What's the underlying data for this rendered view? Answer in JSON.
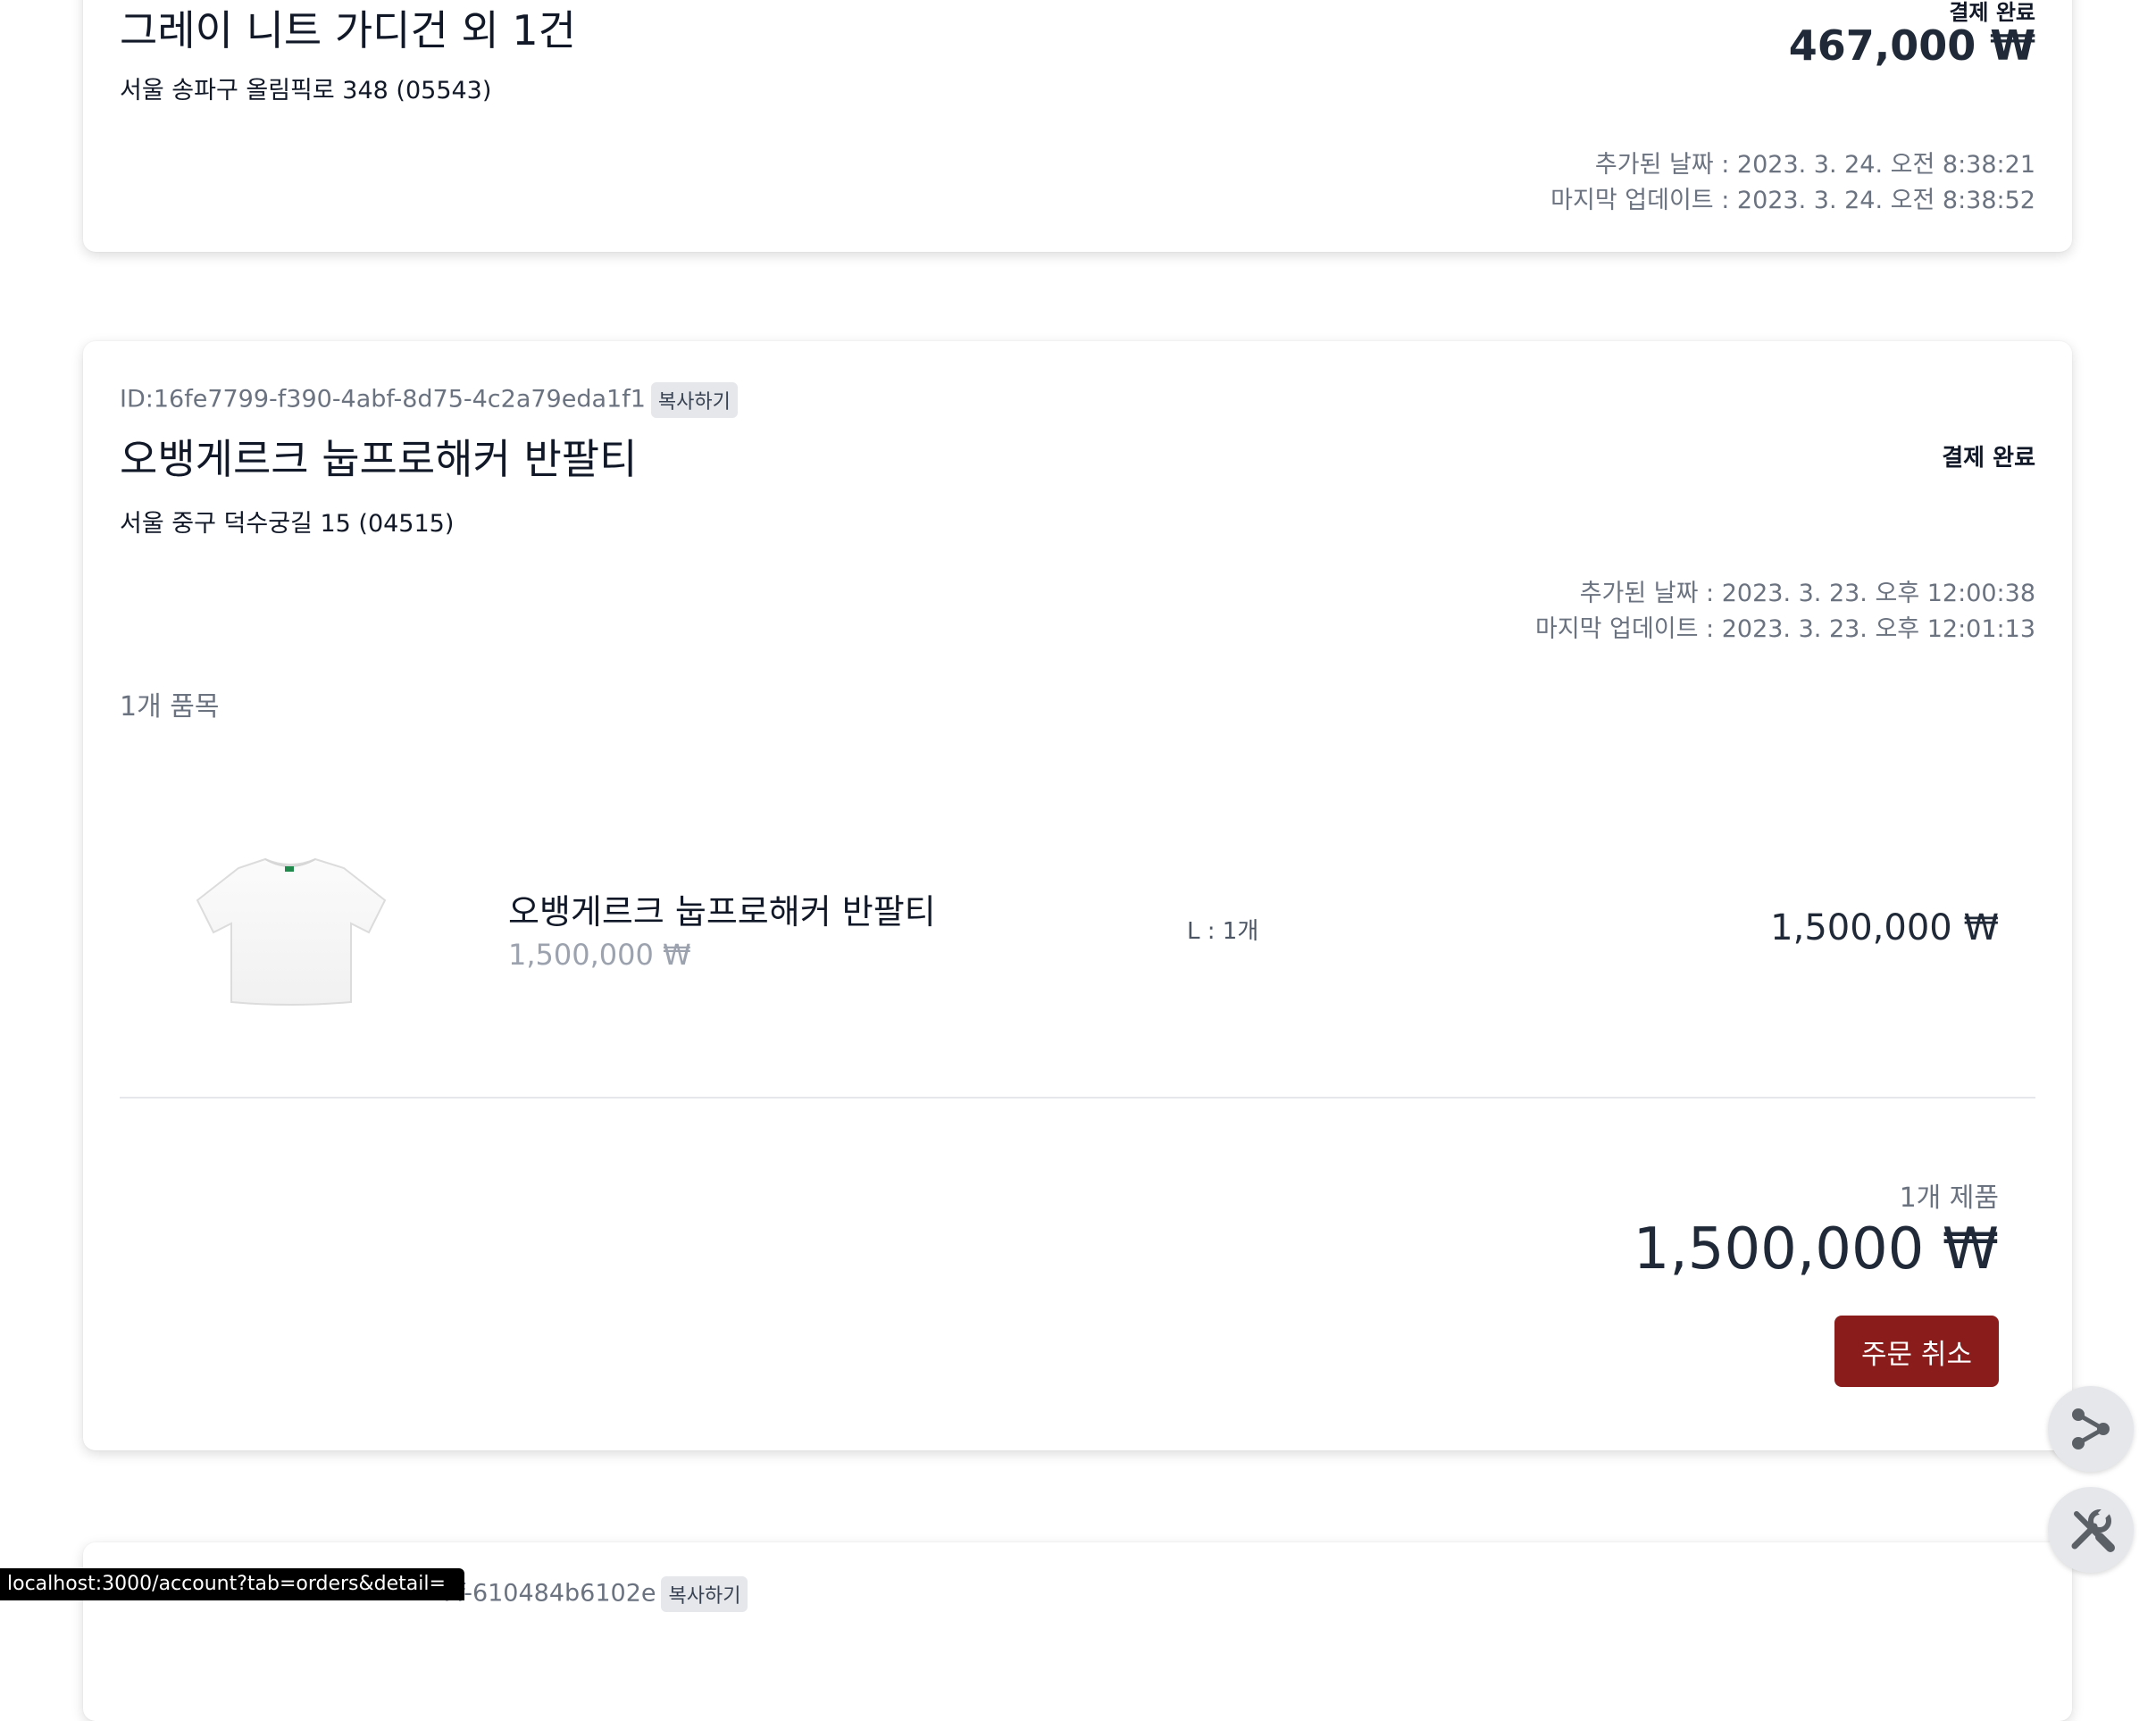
{
  "orders": [
    {
      "status": "결제 완료",
      "title": "그레이 니트 가디건 외 1건",
      "total": "467,000 ₩",
      "address": "서울 송파구 올림픽로 348  (05543)",
      "added": "추가된 날짜 : 2023. 3. 24. 오전 8:38:21",
      "updated": "마지막 업데이트 : 2023. 3. 24. 오전 8:38:52"
    },
    {
      "id": "ID:16fe7799-f390-4abf-8d75-4c2a79eda1f1",
      "copy_label": "복사하기",
      "title": "오뱅게르크 눕프로해커 반팔티",
      "status": "결제 완료",
      "address": "서울 중구 덕수궁길 15  (04515)",
      "added": "추가된 날짜 : 2023. 3. 23. 오후 12:00:38",
      "updated": "마지막 업데이트 : 2023. 3. 23. 오후 12:01:13",
      "item_count": "1개 품목",
      "items": [
        {
          "name": "오뱅게르크 눕프로해커 반팔티",
          "price": "1,500,000 ₩",
          "option": "L : 1개",
          "total": "1,500,000 ₩"
        }
      ],
      "product_count": "1개 제품",
      "grand_total": "1,500,000 ₩",
      "cancel_label": "주문 취소"
    },
    {
      "id_visible": "7f-610484b6102e",
      "copy_label": "복사하기"
    }
  ],
  "fab": {
    "share_icon": "share-icon",
    "tools_icon": "tools-icon"
  },
  "statusbar": {
    "url": "localhost:3000/account?tab=orders&detail="
  }
}
